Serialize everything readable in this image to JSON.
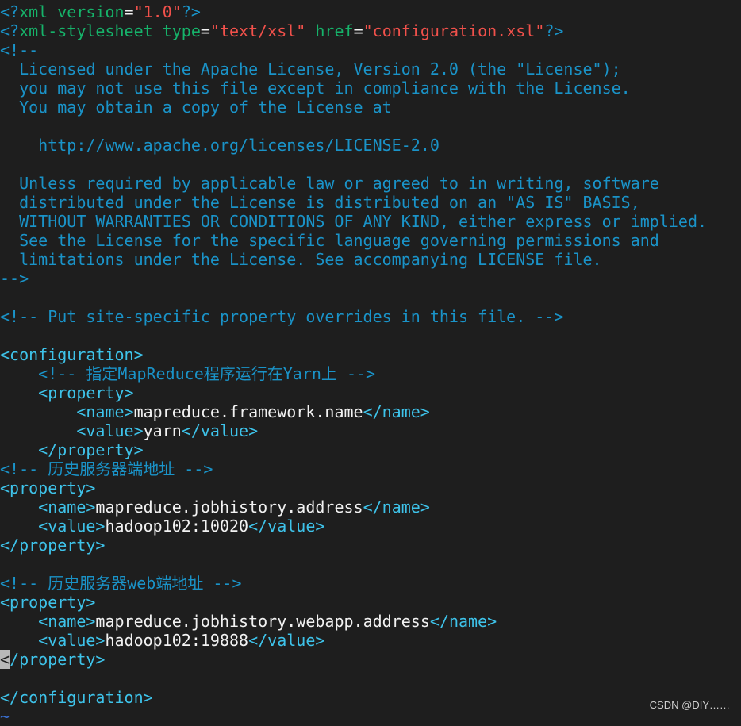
{
  "editor": {
    "colors": {
      "comment": "#1a93c8",
      "attr": "#16b36a",
      "string": "#f2514b",
      "text": "#f2f2f2",
      "tag": "#3ec3ea",
      "background": "#1e1e1e"
    },
    "lines": [
      [
        {
          "t": "<?",
          "c": "b"
        },
        {
          "t": "xml version",
          "c": "g"
        },
        {
          "t": "=",
          "c": "w"
        },
        {
          "t": "\"1.0\"",
          "c": "r"
        },
        {
          "t": "?>",
          "c": "b"
        }
      ],
      [
        {
          "t": "<?",
          "c": "b"
        },
        {
          "t": "xml-stylesheet type",
          "c": "g"
        },
        {
          "t": "=",
          "c": "w"
        },
        {
          "t": "\"text/xsl\"",
          "c": "r"
        },
        {
          "t": " href",
          "c": "g"
        },
        {
          "t": "=",
          "c": "w"
        },
        {
          "t": "\"configuration.xsl\"",
          "c": "r"
        },
        {
          "t": "?>",
          "c": "b"
        }
      ],
      [
        {
          "t": "<!--",
          "c": "b"
        }
      ],
      [
        {
          "t": "  Licensed under the Apache License, Version 2.0 (the \"License\");",
          "c": "b"
        }
      ],
      [
        {
          "t": "  you may not use this file except in compliance with the License.",
          "c": "b"
        }
      ],
      [
        {
          "t": "  You may obtain a copy of the License at",
          "c": "b"
        }
      ],
      [],
      [
        {
          "t": "    http://www.apache.org/licenses/LICENSE-2.0",
          "c": "b"
        }
      ],
      [],
      [
        {
          "t": "  Unless required by applicable law or agreed to in writing, software",
          "c": "b"
        }
      ],
      [
        {
          "t": "  distributed under the License is distributed on an \"AS IS\" BASIS,",
          "c": "b"
        }
      ],
      [
        {
          "t": "  WITHOUT WARRANTIES OR CONDITIONS OF ANY KIND, either express or implied.",
          "c": "b"
        }
      ],
      [
        {
          "t": "  See the License for the specific language governing permissions and",
          "c": "b"
        }
      ],
      [
        {
          "t": "  limitations under the License. See accompanying LICENSE file.",
          "c": "b"
        }
      ],
      [
        {
          "t": "-->",
          "c": "b"
        }
      ],
      [],
      [
        {
          "t": "<!-- Put site-specific property overrides in this file. -->",
          "c": "b"
        }
      ],
      [],
      [
        {
          "t": "<configuration>",
          "c": "c"
        }
      ],
      [
        {
          "t": "    <!-- 指定MapReduce程序运行在Yarn上 -->",
          "c": "b"
        }
      ],
      [
        {
          "t": "    <property>",
          "c": "c"
        }
      ],
      [
        {
          "t": "        <name>",
          "c": "c"
        },
        {
          "t": "mapreduce.framework.name",
          "c": "w"
        },
        {
          "t": "</name>",
          "c": "c"
        }
      ],
      [
        {
          "t": "        <value>",
          "c": "c"
        },
        {
          "t": "yarn",
          "c": "w"
        },
        {
          "t": "</value>",
          "c": "c"
        }
      ],
      [
        {
          "t": "    </property>",
          "c": "c"
        }
      ],
      [
        {
          "t": "<!-- 历史服务器端地址 -->",
          "c": "b"
        }
      ],
      [
        {
          "t": "<property>",
          "c": "c"
        }
      ],
      [
        {
          "t": "    <name>",
          "c": "c"
        },
        {
          "t": "mapreduce.jobhistory.address",
          "c": "w"
        },
        {
          "t": "</name>",
          "c": "c"
        }
      ],
      [
        {
          "t": "    <value>",
          "c": "c"
        },
        {
          "t": "hadoop102:10020",
          "c": "w"
        },
        {
          "t": "</value>",
          "c": "c"
        }
      ],
      [
        {
          "t": "</property>",
          "c": "c"
        }
      ],
      [],
      [
        {
          "t": "<!-- 历史服务器web端地址 -->",
          "c": "b"
        }
      ],
      [
        {
          "t": "<property>",
          "c": "c"
        }
      ],
      [
        {
          "t": "    <name>",
          "c": "c"
        },
        {
          "t": "mapreduce.jobhistory.webapp.address",
          "c": "w"
        },
        {
          "t": "</name>",
          "c": "c"
        }
      ],
      [
        {
          "t": "    <value>",
          "c": "c"
        },
        {
          "t": "hadoop102:19888",
          "c": "w"
        },
        {
          "t": "</value>",
          "c": "c"
        }
      ],
      [
        {
          "t": "<",
          "c": "cur"
        },
        {
          "t": "/property>",
          "c": "c"
        }
      ],
      [],
      [
        {
          "t": "</configuration>",
          "c": "c"
        }
      ],
      [
        {
          "t": "~",
          "c": "tilde"
        }
      ]
    ]
  },
  "watermark": "CSDN @DIY……"
}
